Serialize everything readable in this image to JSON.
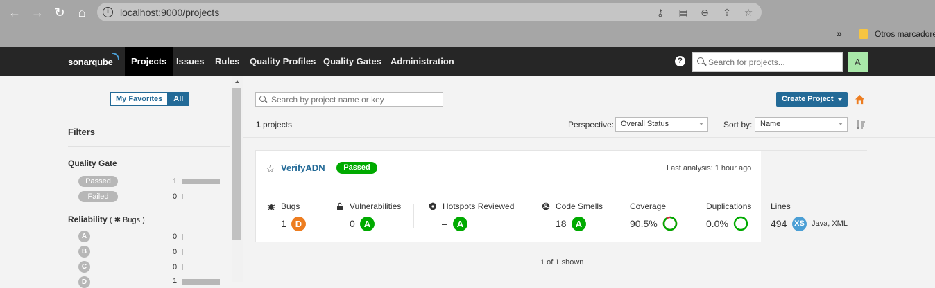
{
  "browser": {
    "url": "localhost:9000/projects",
    "bookmark_more": "»",
    "bookmark_folder": "Otros marcadores"
  },
  "navbar": {
    "logo": "sonarqube",
    "items": [
      "Projects",
      "Issues",
      "Rules",
      "Quality Profiles",
      "Quality Gates",
      "Administration"
    ],
    "active": "Projects",
    "search_placeholder": "Search for projects...",
    "avatar_letter": "A"
  },
  "sidebar": {
    "favorites_label": "My Favorites",
    "all_label": "All",
    "filters_title": "Filters",
    "quality_gate": {
      "title": "Quality Gate",
      "options": [
        {
          "label": "Passed",
          "count": "1",
          "fraction": 1.0
        },
        {
          "label": "Failed",
          "count": "0",
          "fraction": 0
        }
      ]
    },
    "reliability": {
      "title": "Reliability",
      "sub": "Bugs",
      "options": [
        {
          "label": "A",
          "count": "0",
          "fraction": 0
        },
        {
          "label": "B",
          "count": "0",
          "fraction": 0
        },
        {
          "label": "C",
          "count": "0",
          "fraction": 0
        },
        {
          "label": "D",
          "count": "1",
          "fraction": 1.0
        }
      ]
    }
  },
  "main": {
    "search_placeholder": "Search by project name or key",
    "create_button": "Create Project",
    "project_count": "1",
    "project_count_suffix": "projects",
    "perspective_label": "Perspective:",
    "perspective_value": "Overall Status",
    "sort_label": "Sort by:",
    "sort_value": "Name",
    "footer": "1 of 1 shown"
  },
  "project": {
    "name": "VerifyADN",
    "gate": "Passed",
    "last_analysis": "Last analysis: 1 hour ago",
    "metrics": {
      "bugs": {
        "label": "Bugs",
        "value": "1",
        "rating": "D"
      },
      "vulnerabilities": {
        "label": "Vulnerabilities",
        "value": "0",
        "rating": "A"
      },
      "hotspots": {
        "label": "Hotspots Reviewed",
        "value": "–",
        "rating": "A"
      },
      "code_smells": {
        "label": "Code Smells",
        "value": "18",
        "rating": "A"
      },
      "coverage": {
        "label": "Coverage",
        "value": "90.5%",
        "fraction": 0.905
      },
      "duplications": {
        "label": "Duplications",
        "value": "0.0%"
      },
      "lines": {
        "label": "Lines",
        "value": "494",
        "size": "XS",
        "languages": "Java, XML"
      }
    }
  },
  "colors": {
    "rating_a": "#00aa00",
    "rating_d": "#ed7d20",
    "brand_blue": "#236a97",
    "size_badge": "#4b9fd5"
  }
}
